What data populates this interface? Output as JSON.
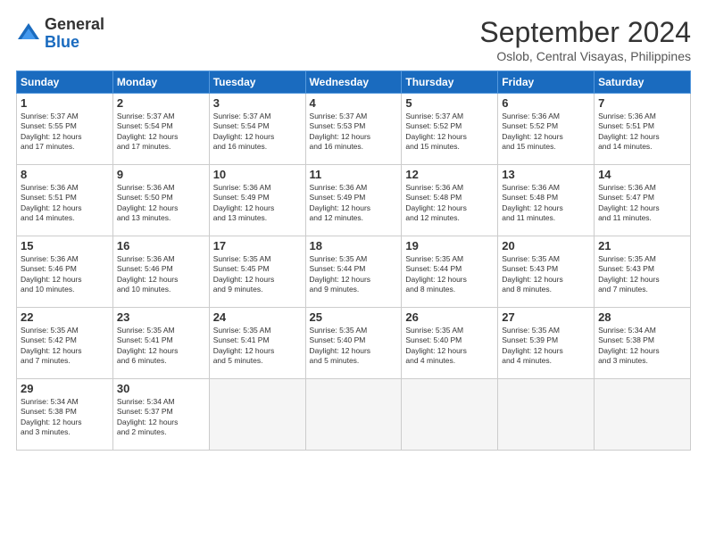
{
  "header": {
    "logo": {
      "general": "General",
      "blue": "Blue"
    },
    "title": "September 2024",
    "location": "Oslob, Central Visayas, Philippines"
  },
  "calendar": {
    "weekdays": [
      "Sunday",
      "Monday",
      "Tuesday",
      "Wednesday",
      "Thursday",
      "Friday",
      "Saturday"
    ],
    "weeks": [
      [
        {
          "day": null
        },
        {
          "day": null
        },
        {
          "day": null
        },
        {
          "day": null
        },
        {
          "day": "5",
          "sunrise": "5:37 AM",
          "sunset": "5:52 PM",
          "daylight": "12 hours and 15 minutes."
        },
        {
          "day": "6",
          "sunrise": "5:36 AM",
          "sunset": "5:52 PM",
          "daylight": "12 hours and 15 minutes."
        },
        {
          "day": "7",
          "sunrise": "5:36 AM",
          "sunset": "5:51 PM",
          "daylight": "12 hours and 14 minutes."
        }
      ],
      [
        {
          "day": "1",
          "sunrise": "5:37 AM",
          "sunset": "5:55 PM",
          "daylight": "12 hours and 17 minutes."
        },
        {
          "day": "2",
          "sunrise": "5:37 AM",
          "sunset": "5:54 PM",
          "daylight": "12 hours and 17 minutes."
        },
        {
          "day": "3",
          "sunrise": "5:37 AM",
          "sunset": "5:54 PM",
          "daylight": "12 hours and 16 minutes."
        },
        {
          "day": "4",
          "sunrise": "5:37 AM",
          "sunset": "5:53 PM",
          "daylight": "12 hours and 16 minutes."
        },
        {
          "day": "5",
          "sunrise": "5:37 AM",
          "sunset": "5:52 PM",
          "daylight": "12 hours and 15 minutes."
        },
        {
          "day": "6",
          "sunrise": "5:36 AM",
          "sunset": "5:52 PM",
          "daylight": "12 hours and 15 minutes."
        },
        {
          "day": "7",
          "sunrise": "5:36 AM",
          "sunset": "5:51 PM",
          "daylight": "12 hours and 14 minutes."
        }
      ],
      [
        {
          "day": "8",
          "sunrise": "5:36 AM",
          "sunset": "5:51 PM",
          "daylight": "12 hours and 14 minutes."
        },
        {
          "day": "9",
          "sunrise": "5:36 AM",
          "sunset": "5:50 PM",
          "daylight": "12 hours and 13 minutes."
        },
        {
          "day": "10",
          "sunrise": "5:36 AM",
          "sunset": "5:49 PM",
          "daylight": "12 hours and 13 minutes."
        },
        {
          "day": "11",
          "sunrise": "5:36 AM",
          "sunset": "5:49 PM",
          "daylight": "12 hours and 12 minutes."
        },
        {
          "day": "12",
          "sunrise": "5:36 AM",
          "sunset": "5:48 PM",
          "daylight": "12 hours and 12 minutes."
        },
        {
          "day": "13",
          "sunrise": "5:36 AM",
          "sunset": "5:48 PM",
          "daylight": "12 hours and 11 minutes."
        },
        {
          "day": "14",
          "sunrise": "5:36 AM",
          "sunset": "5:47 PM",
          "daylight": "12 hours and 11 minutes."
        }
      ],
      [
        {
          "day": "15",
          "sunrise": "5:36 AM",
          "sunset": "5:46 PM",
          "daylight": "12 hours and 10 minutes."
        },
        {
          "day": "16",
          "sunrise": "5:36 AM",
          "sunset": "5:46 PM",
          "daylight": "12 hours and 10 minutes."
        },
        {
          "day": "17",
          "sunrise": "5:35 AM",
          "sunset": "5:45 PM",
          "daylight": "12 hours and 9 minutes."
        },
        {
          "day": "18",
          "sunrise": "5:35 AM",
          "sunset": "5:44 PM",
          "daylight": "12 hours and 9 minutes."
        },
        {
          "day": "19",
          "sunrise": "5:35 AM",
          "sunset": "5:44 PM",
          "daylight": "12 hours and 8 minutes."
        },
        {
          "day": "20",
          "sunrise": "5:35 AM",
          "sunset": "5:43 PM",
          "daylight": "12 hours and 8 minutes."
        },
        {
          "day": "21",
          "sunrise": "5:35 AM",
          "sunset": "5:43 PM",
          "daylight": "12 hours and 7 minutes."
        }
      ],
      [
        {
          "day": "22",
          "sunrise": "5:35 AM",
          "sunset": "5:42 PM",
          "daylight": "12 hours and 7 minutes."
        },
        {
          "day": "23",
          "sunrise": "5:35 AM",
          "sunset": "5:41 PM",
          "daylight": "12 hours and 6 minutes."
        },
        {
          "day": "24",
          "sunrise": "5:35 AM",
          "sunset": "5:41 PM",
          "daylight": "12 hours and 5 minutes."
        },
        {
          "day": "25",
          "sunrise": "5:35 AM",
          "sunset": "5:40 PM",
          "daylight": "12 hours and 5 minutes."
        },
        {
          "day": "26",
          "sunrise": "5:35 AM",
          "sunset": "5:40 PM",
          "daylight": "12 hours and 4 minutes."
        },
        {
          "day": "27",
          "sunrise": "5:35 AM",
          "sunset": "5:39 PM",
          "daylight": "12 hours and 4 minutes."
        },
        {
          "day": "28",
          "sunrise": "5:34 AM",
          "sunset": "5:38 PM",
          "daylight": "12 hours and 3 minutes."
        }
      ],
      [
        {
          "day": "29",
          "sunrise": "5:34 AM",
          "sunset": "5:38 PM",
          "daylight": "12 hours and 3 minutes."
        },
        {
          "day": "30",
          "sunrise": "5:34 AM",
          "sunset": "5:37 PM",
          "daylight": "12 hours and 2 minutes."
        },
        {
          "day": null
        },
        {
          "day": null
        },
        {
          "day": null
        },
        {
          "day": null
        },
        {
          "day": null
        }
      ]
    ]
  }
}
